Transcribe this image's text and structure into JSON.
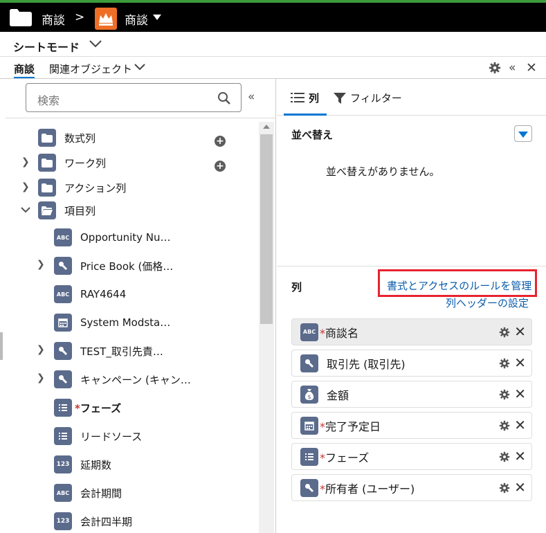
{
  "topbar": {
    "crumb1": "商談",
    "separator": ">",
    "crumb2": "商談"
  },
  "modebar": {
    "mode_label": "シートモード"
  },
  "objbar": {
    "tab_active": "商談",
    "tab_related": "関連オブジェクト"
  },
  "search": {
    "placeholder": "検索"
  },
  "tree": [
    {
      "label": "数式列",
      "icon": "folder"
    },
    {
      "label": "ワーク列",
      "icon": "folder"
    },
    {
      "label": "アクション列",
      "icon": "folder"
    },
    {
      "label": "項目列",
      "icon": "folder-open"
    },
    {
      "label": "Opportunity Nu…",
      "icon": "ABC"
    },
    {
      "label": "Price Book (価格…",
      "icon": "lookup"
    },
    {
      "label": "RAY4644",
      "icon": "ABC"
    },
    {
      "label": "System Modsta…",
      "icon": "calendar"
    },
    {
      "label": "TEST_取引先責…",
      "icon": "lookup"
    },
    {
      "label": "キャンペーン (キャン…",
      "icon": "lookup"
    },
    {
      "label": "フェーズ",
      "icon": "picklist",
      "required": "*"
    },
    {
      "label": "リードソース",
      "icon": "picklist"
    },
    {
      "label": "延期数",
      "icon": "123"
    },
    {
      "label": "会計期間",
      "icon": "ABC"
    },
    {
      "label": "会計四半期",
      "icon": "123"
    }
  ],
  "tabs": {
    "columns": "列",
    "filter": "フィルター"
  },
  "sort": {
    "title": "並べ替え",
    "empty": "並べ替えがありません。"
  },
  "columns": {
    "title": "列",
    "manage_link": "書式とアクセスのルールを管理",
    "header_settings": "列ヘッダーの設定",
    "items": [
      {
        "label": "商談名",
        "icon": "ABC",
        "required": "*"
      },
      {
        "label": "取引先 (取引先)",
        "icon": "lookup",
        "required": ""
      },
      {
        "label": "金額",
        "icon": "money",
        "required": ""
      },
      {
        "label": "完了予定日",
        "icon": "calendar",
        "required": "*"
      },
      {
        "label": "フェーズ",
        "icon": "picklist",
        "required": "*"
      },
      {
        "label": "所有者 (ユーザー)",
        "icon": "lookup",
        "required": "*"
      }
    ]
  },
  "colors": {
    "accent": "#0176d3",
    "icon_bg": "#5b6b8c",
    "highlight_border": "#e8232f",
    "topbar_bg": "#000000",
    "crown_bg": "#ef6e27"
  }
}
